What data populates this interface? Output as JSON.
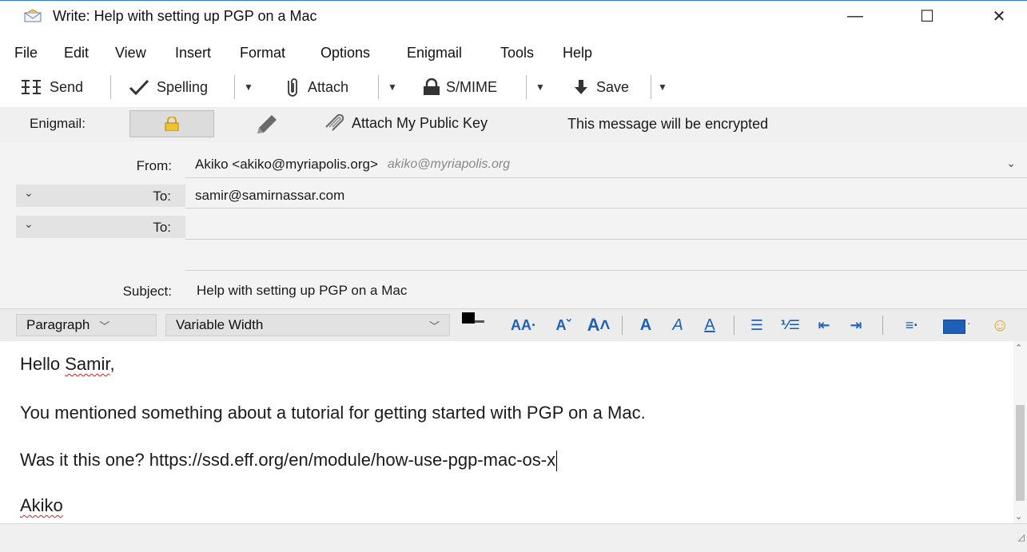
{
  "window": {
    "title": "Write: Help with setting up PGP on a Mac",
    "minimize_glyph": "—",
    "maximize_glyph": "☐",
    "close_glyph": "✕"
  },
  "menu": [
    "File",
    "Edit",
    "View",
    "Insert",
    "Format",
    "Options",
    "Enigmail",
    "Tools",
    "Help"
  ],
  "toolbar": {
    "send_label": "Send",
    "spelling_label": "Spelling",
    "attach_label": "Attach",
    "smime_label": "S/MIME",
    "save_label": "Save"
  },
  "enigmail": {
    "label": "Enigmail:",
    "attach_key_label": "Attach My Public Key",
    "status_text": "This message will be encrypted"
  },
  "header": {
    "from_label": "From:",
    "from_value": "Akiko <akiko@myriapolis.org>",
    "from_identity": "akiko@myriapolis.org",
    "to_label": "To:",
    "to_value_1": "samir@samirnassar.com",
    "to_value_2": "",
    "subject_label": "Subject:",
    "subject_value": "Help with setting up PGP on a Mac"
  },
  "format": {
    "paragraph_label": "Paragraph",
    "font_label": "Variable Width"
  },
  "body": {
    "greeting_word": "Hello ",
    "greeting_name": "Samir",
    "greeting_punct": ",",
    "line2": "You mentioned something about a tutorial for getting started with PGP on a Mac.",
    "line3": "Was it this one? https://ssd.eff.org/en/module/how-use-pgp-mac-os-x",
    "signature": "Akiko"
  },
  "icons": {
    "window": "compose-envelope-icon",
    "send": "send-icon",
    "spelling": "checkmark-icon",
    "attach": "paperclip-icon",
    "smime": "lock-icon",
    "save": "download-arrow-icon",
    "enigmail_encrypt": "lock-toggle-icon",
    "enigmail_sign": "pencil-icon",
    "attach_key": "paperclip-icon",
    "emoji": "smiley-icon"
  },
  "colors": {
    "format_blue": "#1e5fb8",
    "spell_underline": "#d62020",
    "titlebar_border": "#2b7bd6"
  }
}
